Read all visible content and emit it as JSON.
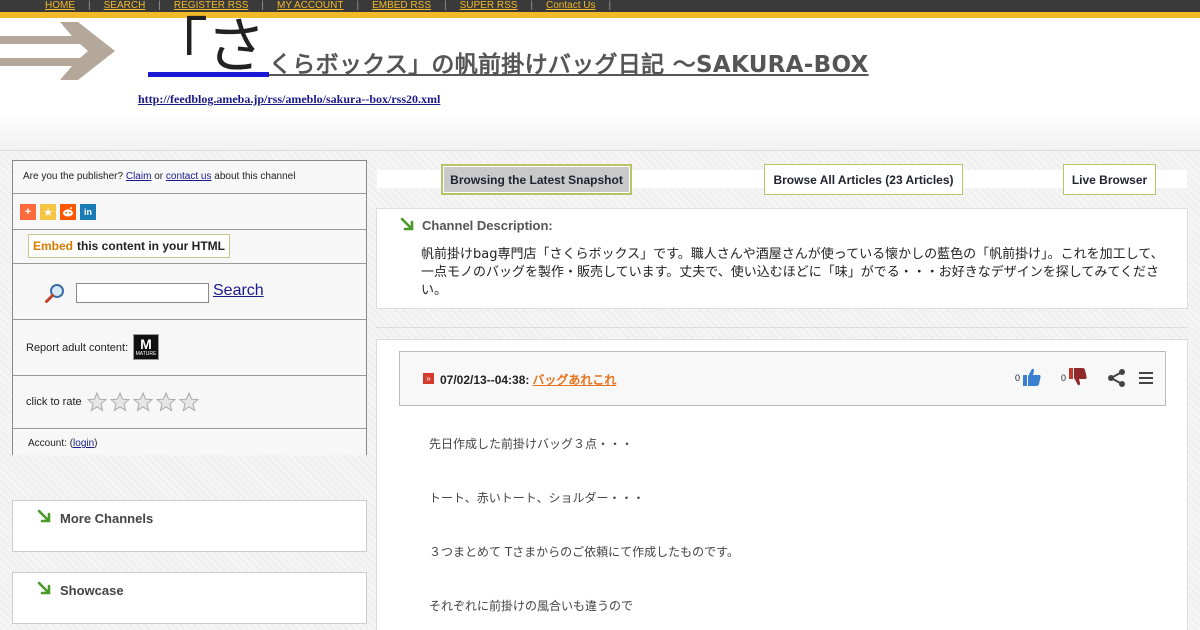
{
  "nav": {
    "items": [
      "HOME",
      "SEARCH",
      "REGISTER RSS",
      "MY ACCOUNT",
      "EMBED RSS",
      "SUPER RSS",
      "Contact Us"
    ]
  },
  "header": {
    "title_big": "「さ",
    "title_rest": "くらボックス」の帆前掛けバッグ日記 ～SAKURA-BOX",
    "feed_url": "http://feedblog.ameba.jp/rss/ameblo/sakura--box/rss20.xml"
  },
  "sidebar": {
    "publisher_prefix": "Are you the publisher?",
    "claim_link": "Claim",
    "or_text": "or",
    "contact_link": "contact us",
    "publisher_suffix": "about this channel",
    "embed_word": "Embed",
    "embed_rest": "this content in your HTML",
    "search_input_value": "",
    "search_button": "Search",
    "adult_label": "Report adult content:",
    "mature_badge_letter": "M",
    "mature_badge_sub": "MATURE",
    "rate_label": "click to rate",
    "rating_max": 5,
    "account_prefix": "Account: (",
    "login_link": "login",
    "account_suffix": ")",
    "more_channels": "More Channels",
    "showcase": "Showcase"
  },
  "tabs": {
    "snapshot": "Browsing the Latest Snapshot",
    "all_articles": "Browse All Articles (23 Articles)",
    "live_browser": "Live Browser"
  },
  "description": {
    "title": "Channel Description:",
    "text": "帆前掛けbag専門店「さくらボックス」です。職人さんや酒屋さんが使っている懐かしの藍色の「帆前掛け」。これを加工して、一点モノのバッグを製作・販売しています。丈夫で、使い込むほどに「味」がでる・・・お好きなデザインを探してみてください。"
  },
  "article": {
    "date": "07/02/13--04:38:",
    "link_text": "バッグあれこれ",
    "thumbs_up_count": "0",
    "thumbs_down_count": "0",
    "paragraphs": [
      "先日作成した前掛けバッグ３点・・・",
      "トート、赤いトート、ショルダー・・・",
      "３つまとめて Tさまからのご依頼にて作成したものです。",
      "それぞれに前掛けの風合いも違うので"
    ]
  },
  "colors": {
    "nav_bg": "#3a3a3a",
    "nav_accent": "#f2b928",
    "link_blue": "#1a1a8c",
    "article_link": "#e8731a",
    "green_arrow": "#4a9a2a"
  }
}
